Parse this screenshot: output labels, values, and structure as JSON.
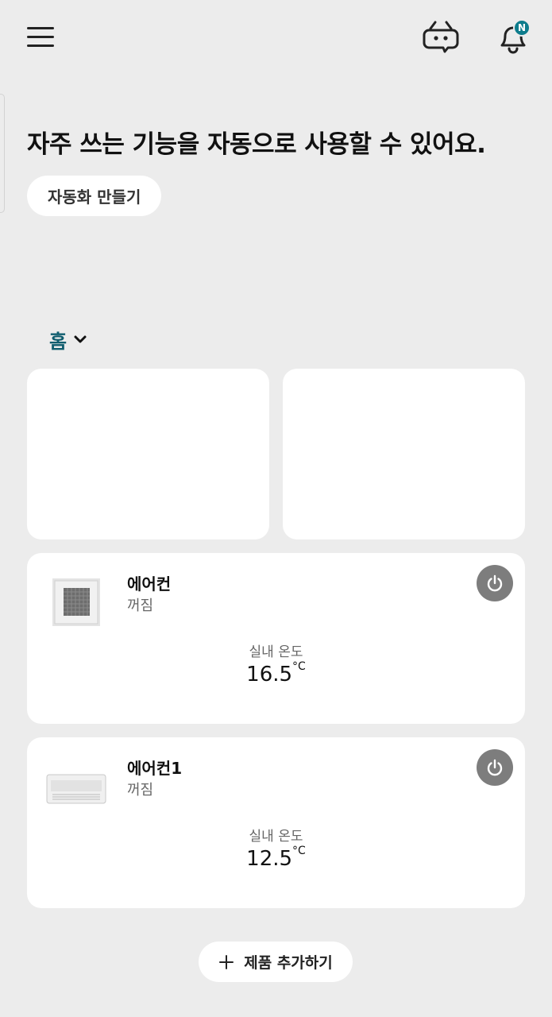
{
  "header": {
    "menu_icon": "hamburger-menu-icon",
    "chatbot_icon": "chatbot-icon",
    "bell_icon": "bell-icon",
    "notification_badge": "N"
  },
  "automation": {
    "headline": "자주 쓰는 기능을 자동으로 사용할 수 있어요.",
    "create_button": "자동화 만들기"
  },
  "home_selector": {
    "label": "홈",
    "icon": "chevron-down-icon"
  },
  "devices": [
    {
      "name": "에어컨",
      "status": "꺼짐",
      "temp_label": "실내 온도",
      "temp_value": "16.5",
      "temp_unit": "°C",
      "image": "ceiling-cassette-ac"
    },
    {
      "name": "에어컨1",
      "status": "꺼짐",
      "temp_label": "실내 온도",
      "temp_value": "12.5",
      "temp_unit": "°C",
      "image": "wall-mounted-ac"
    }
  ],
  "add_product": {
    "label": "제품 추가하기",
    "icon": "plus-icon"
  },
  "colors": {
    "background": "#ececec",
    "accent": "#0f5d6e",
    "badge": "#0d7c8c",
    "power_button": "#7d7d7d"
  }
}
